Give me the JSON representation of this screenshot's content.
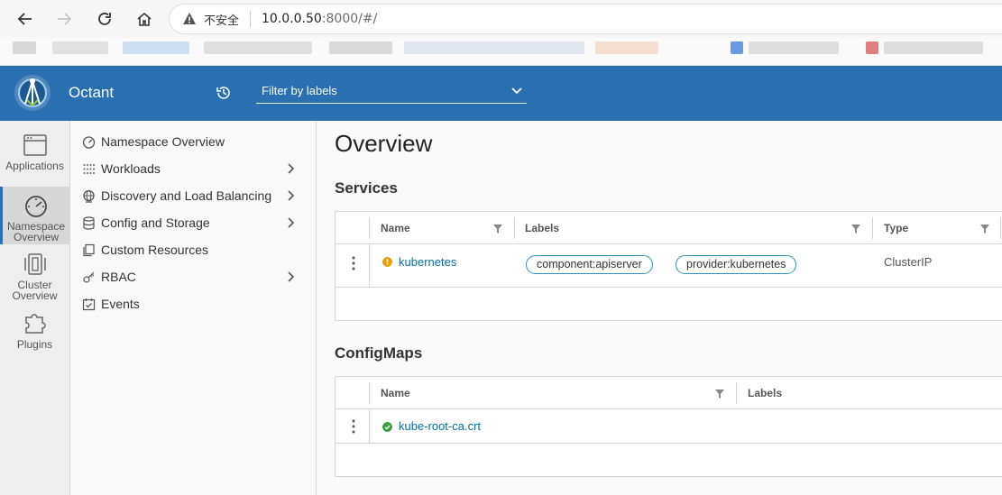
{
  "browser": {
    "insecure_label": "不安全",
    "url_host": "10.0.0.50",
    "url_rest": ":8000/#/"
  },
  "header": {
    "app_title": "Octant",
    "filter_placeholder": "Filter by labels",
    "brand_color": "#2a6fb0"
  },
  "rail": {
    "items": [
      {
        "label": "Applications",
        "icon": "window-icon"
      },
      {
        "label": "Namespace Overview",
        "icon": "dashboard-gauge-icon"
      },
      {
        "label": "Cluster Overview",
        "icon": "cluster-icon"
      },
      {
        "label": "Plugins",
        "icon": "plugin-puzzle-icon"
      }
    ]
  },
  "nav": {
    "items": [
      {
        "label": "Namespace Overview",
        "icon": "gauge-icon",
        "has_children": false
      },
      {
        "label": "Workloads",
        "icon": "grid-dots-icon",
        "has_children": true
      },
      {
        "label": "Discovery and Load Balancing",
        "icon": "network-globe-icon",
        "has_children": true
      },
      {
        "label": "Config and Storage",
        "icon": "database-icon",
        "has_children": true
      },
      {
        "label": "Custom Resources",
        "icon": "copy-icon",
        "has_children": false
      },
      {
        "label": "RBAC",
        "icon": "shield-key-icon",
        "has_children": true
      },
      {
        "label": "Events",
        "icon": "calendar-check-icon",
        "has_children": false
      }
    ]
  },
  "main": {
    "page_title": "Overview",
    "services": {
      "title": "Services",
      "columns": [
        "Name",
        "Labels",
        "Type"
      ],
      "rows": [
        {
          "name": "kubernetes",
          "status": "warning",
          "labels": [
            "component:apiserver",
            "provider:kubernetes"
          ],
          "type": "ClusterIP"
        }
      ]
    },
    "configmaps": {
      "title": "ConfigMaps",
      "columns": [
        "Name",
        "Labels"
      ],
      "rows": [
        {
          "name": "kube-root-ca.crt",
          "status": "ok"
        }
      ]
    }
  },
  "colors": {
    "warning": "#e5a00d",
    "ok": "#3da03d",
    "link": "#0072a3",
    "chip_border": "#2f8fc4"
  }
}
